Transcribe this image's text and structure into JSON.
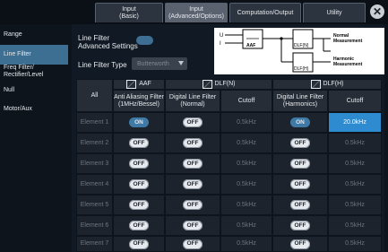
{
  "tabs": [
    {
      "label": "Input\n(Basic)"
    },
    {
      "label": "Input\n(Advanced/Options)"
    },
    {
      "label": "Computation/Output"
    },
    {
      "label": "Utility"
    }
  ],
  "sidebar": {
    "items": [
      {
        "label": "Range"
      },
      {
        "label": "Line Filter"
      },
      {
        "label": "Freq Filter/\nRectifier/Level"
      },
      {
        "label": "Null"
      },
      {
        "label": "Motor/Aux"
      }
    ]
  },
  "settings": {
    "advanced_label": "Line Filter\nAdvanced Settings",
    "advanced_state": "ON",
    "type_label": "Line Filter Type",
    "type_value": "Butterworth"
  },
  "diagram": {
    "u_label": "U",
    "i_label": "I",
    "aaf_label": "AAF",
    "dlf_normal_label": "DLF(N)",
    "dlf_harmonic_label": "DLF(H)",
    "normal_measurement": "Normal\nMeasurement",
    "harmonic_measurement": "Harmonic\nMeasurement"
  },
  "table": {
    "group_headers": [
      "AAF",
      "DLF(N)",
      "DLF(H)"
    ],
    "corner_label": "All",
    "column_headers": [
      "Anti Aliasing Filter\n(1MHz/Bessel)",
      "Digital Line Filter\n(Normal)",
      "Cutoff",
      "Digital Line Filter\n(Harmonics)",
      "Cutoff"
    ],
    "rows": [
      {
        "name": "Element 1",
        "aaf": "ON",
        "dlfn": "OFF",
        "cutoff_n": "0.5kHz",
        "dlfh": "ON",
        "cutoff_h": "20.0kHz"
      },
      {
        "name": "Element 2",
        "aaf": "OFF",
        "dlfn": "OFF",
        "cutoff_n": "0.5kHz",
        "dlfh": "OFF",
        "cutoff_h": "0.5kHz"
      },
      {
        "name": "Element 3",
        "aaf": "OFF",
        "dlfn": "OFF",
        "cutoff_n": "0.5kHz",
        "dlfh": "OFF",
        "cutoff_h": "0.5kHz"
      },
      {
        "name": "Element 4",
        "aaf": "OFF",
        "dlfn": "OFF",
        "cutoff_n": "0.5kHz",
        "dlfh": "OFF",
        "cutoff_h": "0.5kHz"
      },
      {
        "name": "Element 5",
        "aaf": "OFF",
        "dlfn": "OFF",
        "cutoff_n": "0.5kHz",
        "dlfh": "OFF",
        "cutoff_h": "0.5kHz"
      },
      {
        "name": "Element 6",
        "aaf": "OFF",
        "dlfn": "OFF",
        "cutoff_n": "0.5kHz",
        "dlfh": "OFF",
        "cutoff_h": "0.5kHz"
      },
      {
        "name": "Element 7",
        "aaf": "OFF",
        "dlfn": "OFF",
        "cutoff_n": "0.5kHz",
        "dlfh": "OFF",
        "cutoff_h": "0.5kHz"
      }
    ]
  },
  "colors": {
    "accent": "#2f8bd0",
    "on_pill": "#3f7aa7",
    "active_sidebar": "#3d6f92"
  }
}
